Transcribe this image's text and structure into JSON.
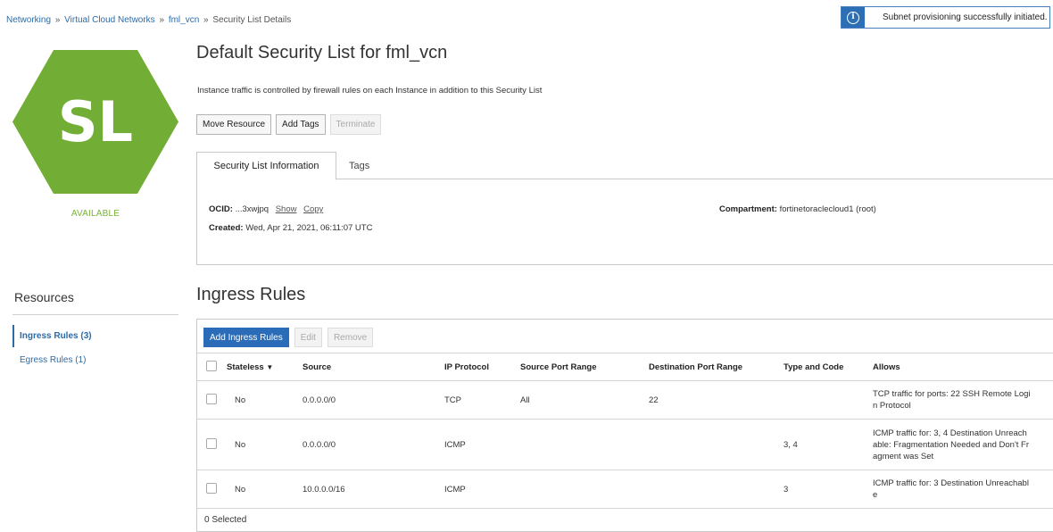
{
  "breadcrumb": {
    "networking": "Networking",
    "vcns": "Virtual Cloud Networks",
    "vcn": "fml_vcn",
    "current": "Security List Details",
    "separator": "»"
  },
  "toast": {
    "icon": "info-icon",
    "message": "Subnet provisioning successfully initiated."
  },
  "resource_icon": {
    "initials": "SL",
    "color": "#72ad35",
    "status": "AVAILABLE"
  },
  "page": {
    "title": "Default Security List for fml_vcn",
    "description": "Instance traffic is controlled by firewall rules on each Instance in addition to this Security List"
  },
  "actions": {
    "move": "Move Resource",
    "add_tags": "Add Tags",
    "terminate": "Terminate"
  },
  "tabs": {
    "info": "Security List Information",
    "tags": "Tags"
  },
  "info": {
    "ocid_label": "OCID:",
    "ocid_value": "...3xwjpq",
    "show": "Show",
    "copy": "Copy",
    "created_label": "Created:",
    "created_value": "Wed, Apr 21, 2021, 06:11:07 UTC",
    "compartment_label": "Compartment:",
    "compartment_value": "fortinetoraclecloud1 (root)"
  },
  "resources": {
    "title": "Resources",
    "ingress": "Ingress Rules (3)",
    "egress": "Egress Rules (1)"
  },
  "ingress": {
    "title": "Ingress Rules",
    "add_button": "Add Ingress Rules",
    "edit_button": "Edit",
    "remove_button": "Remove",
    "columns": {
      "stateless": "Stateless",
      "source": "Source",
      "protocol": "IP Protocol",
      "src_port": "Source Port Range",
      "dst_port": "Destination Port Range",
      "type_code": "Type and Code",
      "allows": "Allows"
    },
    "rows": [
      {
        "stateless": "No",
        "source": "0.0.0.0/0",
        "protocol": "TCP",
        "src_port": "All",
        "dst_port": "22",
        "type_code": "",
        "allows": [
          "TCP traffic for ports: 22 SSH Remote Logi",
          "n Protocol"
        ]
      },
      {
        "stateless": "No",
        "source": "0.0.0.0/0",
        "protocol": "ICMP",
        "src_port": "",
        "dst_port": "",
        "type_code": "3, 4",
        "allows": [
          "ICMP traffic for: 3, 4 Destination Unreach",
          "able: Fragmentation Needed and Don't Fr",
          "agment was Set"
        ]
      },
      {
        "stateless": "No",
        "source": "10.0.0.0/16",
        "protocol": "ICMP",
        "src_port": "",
        "dst_port": "",
        "type_code": "3",
        "allows": [
          "ICMP traffic for: 3 Destination Unreachabl",
          "e"
        ]
      }
    ],
    "footer": "0 Selected"
  }
}
